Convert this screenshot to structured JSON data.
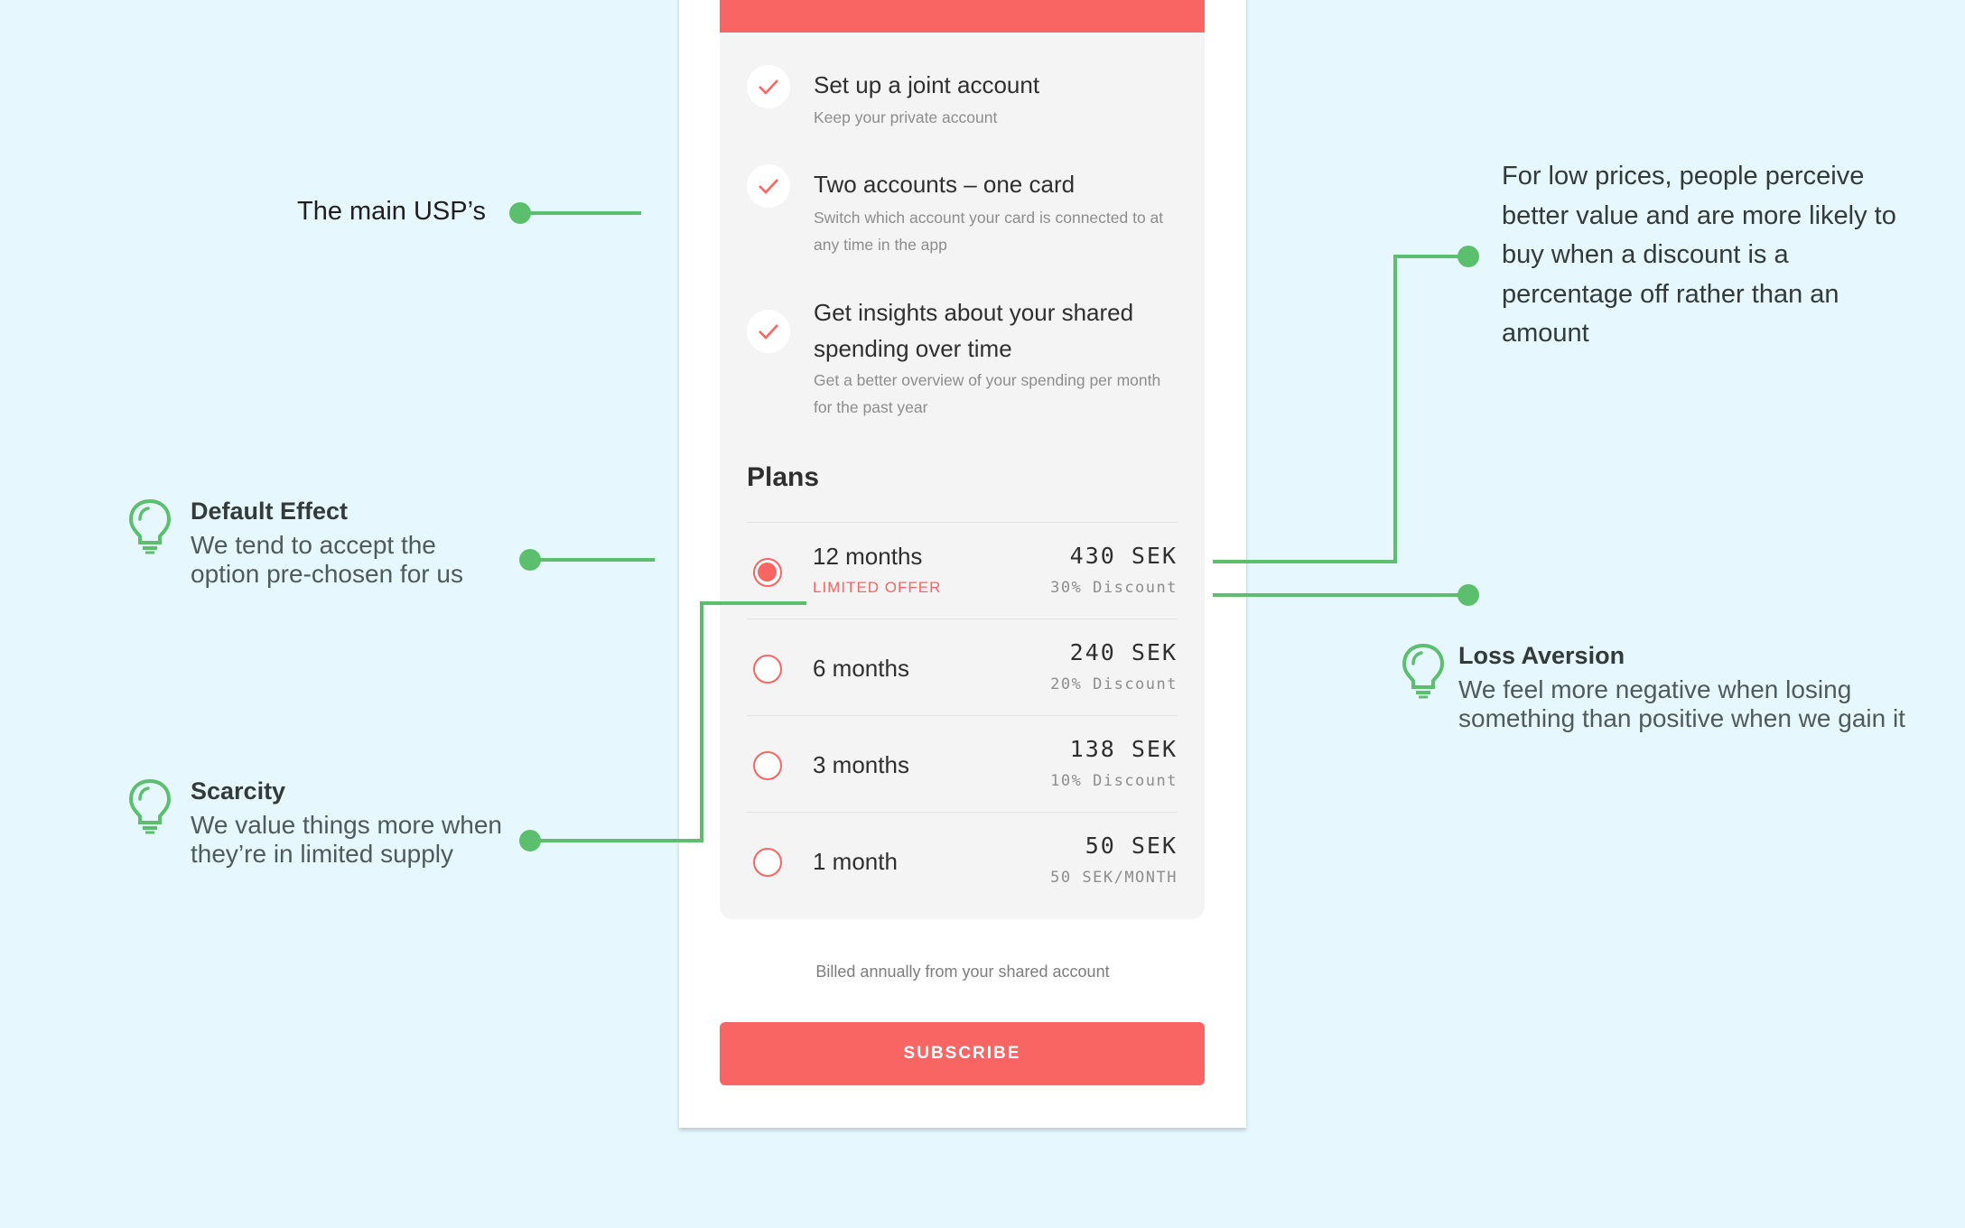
{
  "colors": {
    "accent": "#f96563",
    "annotation": "#5cbf6d",
    "background": "#e6f7fd",
    "panel": "#f4f4f4"
  },
  "usps": [
    {
      "title": "Set up a joint account",
      "subtitle": "Keep your private account",
      "icon": "check-icon"
    },
    {
      "title": "Two accounts – one card",
      "subtitle": "Switch which account your card is connected to at any time in the app",
      "icon": "check-icon"
    },
    {
      "title": "Get insights about your shared spending over time",
      "subtitle": "Get a better overview of your spending per month for the past year",
      "icon": "check-icon"
    }
  ],
  "plans_title": "Plans",
  "plans": [
    {
      "name": "12 months",
      "badge": "LIMITED OFFER",
      "price": "430 SEK",
      "discount": "30% Discount",
      "selected": true
    },
    {
      "name": "6 months",
      "badge": "",
      "price": "240 SEK",
      "discount": "20% Discount",
      "selected": false
    },
    {
      "name": "3 months",
      "badge": "",
      "price": "138 SEK",
      "discount": "10% Discount",
      "selected": false
    },
    {
      "name": "1 month",
      "badge": "",
      "price": "50 SEK",
      "discount": "50 SEK/MONTH",
      "selected": false
    }
  ],
  "billed_note": "Billed annually from your shared account",
  "subscribe_label": "SUBSCRIBE",
  "annotations": {
    "usp_label": "The main USP’s",
    "default_effect": {
      "title": "Default Effect",
      "line1": "We tend to accept the",
      "line2": "option pre-chosen for us",
      "icon": "lightbulb-icon"
    },
    "scarcity": {
      "title": "Scarcity",
      "line1": "We value things more when",
      "line2": "they’re in limited supply",
      "icon": "lightbulb-icon"
    },
    "loss_aversion": {
      "title": "Loss Aversion",
      "line1": "We feel more negative when losing",
      "line2": "something than positive when we gain it",
      "icon": "lightbulb-icon"
    },
    "percentage_note": "For low prices, people perceive better value and are more likely to buy when a discount is a percentage off rather than an amount"
  }
}
